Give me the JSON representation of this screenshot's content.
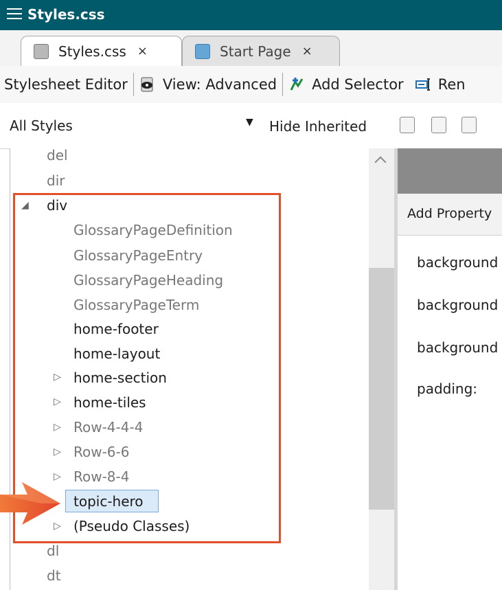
{
  "window": {
    "title": "Styles.css"
  },
  "tabs": [
    {
      "label": "Styles.css",
      "close": "×",
      "active": true
    },
    {
      "label": "Start Page",
      "close": "×",
      "active": false
    }
  ],
  "toolbar": {
    "editor_label": "Stylesheet Editor",
    "view_label": "View: Advanced",
    "add_selector_label": "Add Selector",
    "rename_partial": "Ren"
  },
  "filterbar": {
    "dropdown_value": "All Styles",
    "dropdown_arrow": "▼",
    "hide_inherited_label": "Hide Inherited"
  },
  "tree": {
    "expanded_glyph": "◢",
    "collapsed_glyph": "▷",
    "items": [
      {
        "label": "del"
      },
      {
        "label": "dir"
      },
      {
        "label": "div"
      },
      {
        "label": "GlossaryPageDefinition"
      },
      {
        "label": "GlossaryPageEntry"
      },
      {
        "label": "GlossaryPageHeading"
      },
      {
        "label": "GlossaryPageTerm"
      },
      {
        "label": "home-footer"
      },
      {
        "label": "home-layout"
      },
      {
        "label": "home-section"
      },
      {
        "label": "home-tiles"
      },
      {
        "label": "Row-4-4-4"
      },
      {
        "label": "Row-6-6"
      },
      {
        "label": "Row-8-4"
      },
      {
        "label": "topic-hero"
      },
      {
        "label": "(Pseudo Classes)"
      },
      {
        "label": "dl"
      },
      {
        "label": "dt"
      }
    ]
  },
  "properties_pane": {
    "add_property_label": "Add Property",
    "properties": [
      {
        "label": "background"
      },
      {
        "label": "background"
      },
      {
        "label": "background"
      },
      {
        "label": "padding:"
      }
    ]
  },
  "colors": {
    "titlebar": "#005a6a",
    "highlight_border": "#e2502b",
    "selection_fill": "#dbeaf8",
    "pointer_arrow": "#e8572a"
  }
}
